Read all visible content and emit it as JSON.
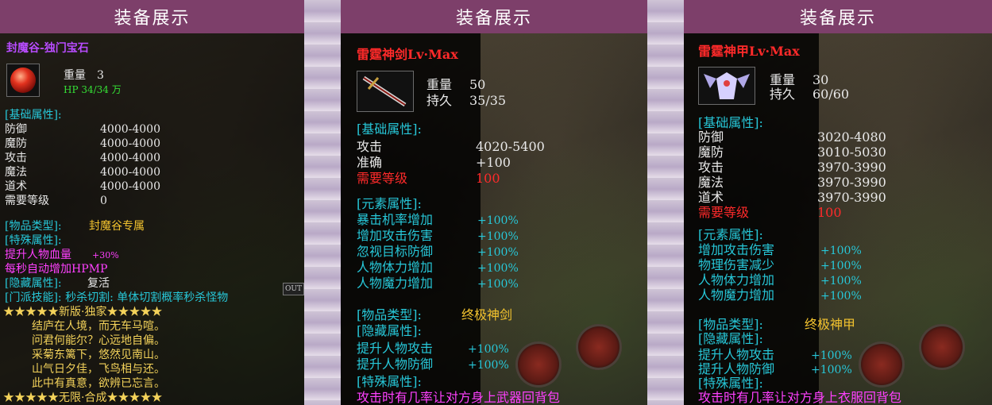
{
  "header": {
    "title": "装备展示"
  },
  "panel1": {
    "title": "封魔谷-独门宝石",
    "weight_label": "重量",
    "weight_value": "3",
    "hp_text": "HP 34/34 万",
    "base_header": "[基础属性]:",
    "stats": [
      {
        "name": "防御",
        "value": "4000-4000"
      },
      {
        "name": "魔防",
        "value": "4000-4000"
      },
      {
        "name": "攻击",
        "value": "4000-4000"
      },
      {
        "name": "魔法",
        "value": "4000-4000"
      },
      {
        "name": "道术",
        "value": "4000-4000"
      },
      {
        "name": "需要等级",
        "value": "0"
      }
    ],
    "type_label": "[物品类型]:",
    "type_value": "封魔谷专属",
    "special_header": "[特殊属性]:",
    "special_1_label": "提升人物血量",
    "special_1_value": "+30%",
    "special_2": "每秒自动增加HPMP",
    "hidden_label": "[隐藏属性]:",
    "hidden_value": "复活",
    "skill_text": "[门派技能]: 秒杀切割: 单体切割概率秒杀怪物",
    "badge_top": "★★★★★新版·独家★★★★★",
    "poem": [
      "结庐在人境，而无车马喧。",
      "问君何能尔？心远地自偏。",
      "采菊东篱下，悠然见南山。",
      "山气日夕佳，飞鸟相与还。",
      "此中有真意，欲辨已忘言。"
    ],
    "badge_bottom": "★★★★★无限·合成★★★★★",
    "corner_text": "OUT"
  },
  "panel2": {
    "title": "雷霆神剑Lv·Max",
    "weight_label": "重量",
    "weight_value": "50",
    "dur_label": "持久",
    "dur_value": "35/35",
    "base_header": "[基础属性]:",
    "stats": [
      {
        "name": "攻击",
        "value": "4020-5400"
      },
      {
        "name": "准确",
        "value": "+100"
      }
    ],
    "req_label": "需要等级",
    "req_value": "100",
    "element_header": "[元素属性]:",
    "elements": [
      {
        "name": "暴击机率增加",
        "value": "+100%"
      },
      {
        "name": "增加攻击伤害",
        "value": "+100%"
      },
      {
        "name": "忽视目标防御",
        "value": "+100%"
      },
      {
        "name": "人物体力增加",
        "value": "+100%"
      },
      {
        "name": "人物魔力增加",
        "value": "+100%"
      }
    ],
    "type_label": "[物品类型]:",
    "type_value": "终极神剑",
    "hidden_header": "[隐藏属性]:",
    "hidden": [
      {
        "name": "提升人物攻击",
        "value": "+100%"
      },
      {
        "name": "提升人物防御",
        "value": "+100%"
      }
    ],
    "special_header": "[特殊属性]:",
    "special_text": "攻击时有几率让对方身上武器回背包"
  },
  "panel3": {
    "title": "雷霆神甲Lv·Max",
    "weight_label": "重量",
    "weight_value": "30",
    "dur_label": "持久",
    "dur_value": "60/60",
    "base_header": "[基础属性]:",
    "stats": [
      {
        "name": "防御",
        "value": "3020-4080"
      },
      {
        "name": "魔防",
        "value": "3010-5030"
      },
      {
        "name": "攻击",
        "value": "3970-3990"
      },
      {
        "name": "魔法",
        "value": "3970-3990"
      },
      {
        "name": "道术",
        "value": "3970-3990"
      }
    ],
    "req_label": "需要等级",
    "req_value": "100",
    "element_header": "[元素属性]:",
    "elements": [
      {
        "name": "增加攻击伤害",
        "value": "+100%"
      },
      {
        "name": "物理伤害减少",
        "value": "+100%"
      },
      {
        "name": "人物体力增加",
        "value": "+100%"
      },
      {
        "name": "人物魔力增加",
        "value": "+100%"
      }
    ],
    "type_label": "[物品类型]:",
    "type_value": "终极神甲",
    "hidden_header": "[隐藏属性]:",
    "hidden": [
      {
        "name": "提升人物攻击",
        "value": "+100%"
      },
      {
        "name": "提升人物防御",
        "value": "+100%"
      }
    ],
    "special_header": "[特殊属性]:",
    "special_text": "攻击时有几率让对方身上衣服回背包"
  }
}
